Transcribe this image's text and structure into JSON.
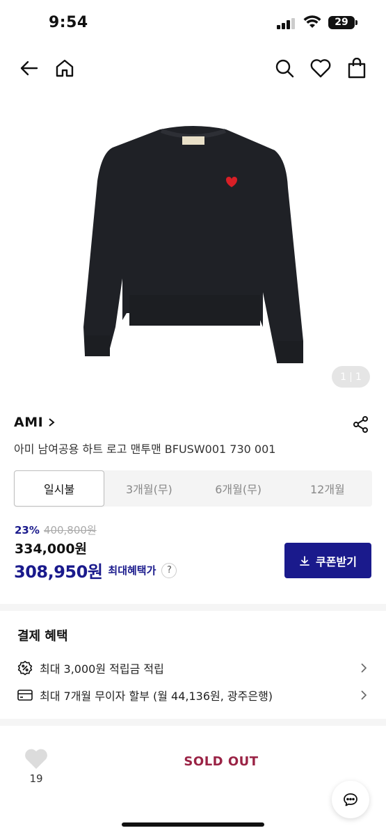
{
  "status_bar": {
    "time": "9:54",
    "battery": "29"
  },
  "product": {
    "image_counter": {
      "current": "1",
      "total": "1"
    },
    "brand": "AMI",
    "name": "아미 남여공용 하트 로고 맨투맨 BFUSW001 730 001"
  },
  "payment_tabs": [
    "일시불",
    "3개월(무)",
    "6개월(무)",
    "12개월"
  ],
  "price": {
    "discount_pct": "23%",
    "original": "400,800원",
    "sale": "334,000원",
    "best": "308,950원",
    "best_label": "최대혜택가",
    "help": "?"
  },
  "coupon_button": "쿠폰받기",
  "benefits": {
    "title": "결제 혜택",
    "items": [
      {
        "icon": "percent-badge-icon",
        "text": "최대 3,000원 적립금 적립"
      },
      {
        "icon": "card-icon",
        "text": "최대 7개월 무이자 할부 (월 44,136원, 광주은행)"
      }
    ]
  },
  "bottom_bar": {
    "like_count": "19",
    "sold_out": "SOLD OUT"
  },
  "colors": {
    "accent": "#1a1a8c",
    "sold_out": "#9a2345"
  }
}
